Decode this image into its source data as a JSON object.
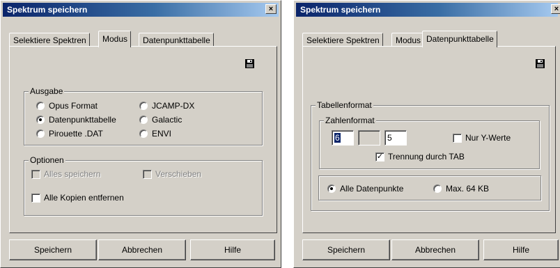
{
  "dialog1": {
    "title": "Spektrum speichern",
    "close_label": "×",
    "tabs": [
      "Selektiere Spektren",
      "Modus",
      "Datenpunkttabelle"
    ],
    "active_tab": "Modus",
    "ausgabe": {
      "legend": "Ausgabe",
      "options": [
        {
          "label": "Opus Format",
          "selected": false
        },
        {
          "label": "JCAMP-DX",
          "selected": false
        },
        {
          "label": "Datenpunkttabelle",
          "selected": true
        },
        {
          "label": "Galactic",
          "selected": false
        },
        {
          "label": "Pirouette .DAT",
          "selected": false
        },
        {
          "label": "ENVI",
          "selected": false
        }
      ]
    },
    "optionen": {
      "legend": "Optionen",
      "alles_speichern": "Alles speichern",
      "verschieben": "Verschieben",
      "alle_kopien": "Alle Kopien entfernen"
    },
    "buttons": {
      "save": "Speichern",
      "cancel": "Abbrechen",
      "help": "Hilfe"
    }
  },
  "dialog2": {
    "title": "Spektrum speichern",
    "close_label": "×",
    "tabs": [
      "Selektiere Spektren",
      "Modus",
      "Datenpunkttabelle"
    ],
    "active_tab": "Datenpunkttabelle",
    "tabellenformat": {
      "legend": "Tabellenformat",
      "zahlenformat": {
        "legend": "Zahlenformat",
        "field1": "6",
        "field2": "",
        "field3": "5",
        "nur_y": "Nur Y-Werte",
        "nur_y_checked": false,
        "trennung": "Trennung durch TAB",
        "trennung_checked": true
      }
    },
    "range": {
      "alle": "Alle Datenpunkte",
      "max": "Max. 64 KB",
      "selected": "alle"
    },
    "buttons": {
      "save": "Speichern",
      "cancel": "Abbrechen",
      "help": "Hilfe"
    }
  },
  "colors": {
    "face": "#d4d0c8",
    "title_start": "#0a246a",
    "title_end": "#a6caf0"
  },
  "icons": {
    "save": "floppy-disk-icon",
    "close": "close-icon"
  }
}
